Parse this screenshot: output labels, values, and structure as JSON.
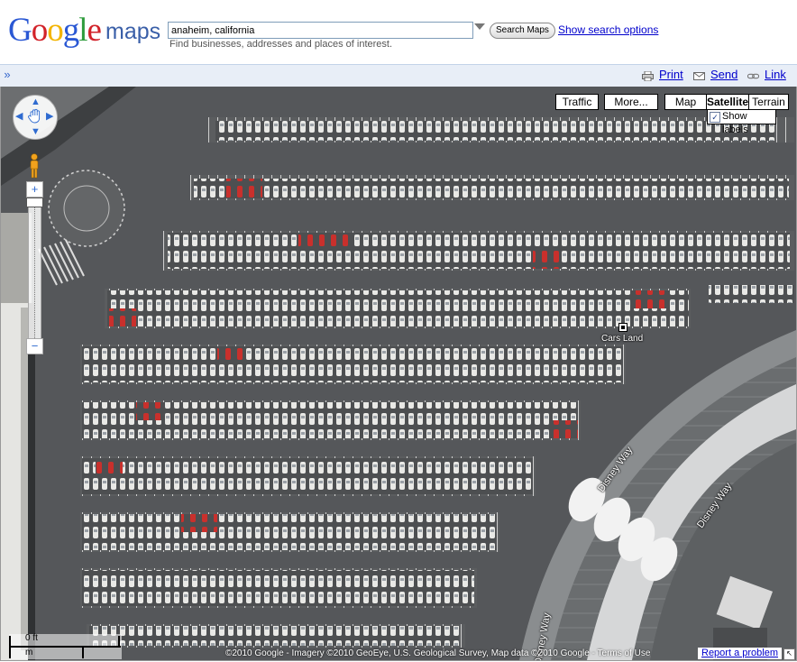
{
  "header": {
    "logo_google": "Google",
    "logo_maps": "maps",
    "search": {
      "value": "anaheim, california",
      "button_label": "Search Maps",
      "options_link": "Show search options",
      "hint": "Find businesses, addresses and places of interest."
    }
  },
  "toolbar": {
    "panel_toggle": "»",
    "print": "Print",
    "send": "Send",
    "link": "Link"
  },
  "map": {
    "map_types": [
      "Traffic",
      "More...",
      "Map",
      "Satellite",
      "Terrain"
    ],
    "active_map_type": "Satellite",
    "show_labels": {
      "label": "Show labels",
      "checked": true
    },
    "zoom": {
      "in": "+",
      "out": "−"
    },
    "place_label": "Cars Land",
    "road_labels": [
      "Disney Way",
      "Disney Way",
      "Disney Way"
    ],
    "scale": {
      "feet": "0 ft",
      "meters": "m"
    },
    "copyright": "©2010 Google - Imagery ©2010 GeoEye, U.S. Geological Survey, Map data ©2010 Google - Terms of Use",
    "report_problem": "Report a problem"
  },
  "colors": {
    "link": "#0000cc",
    "toolbar_bg": "#e8eef7",
    "asphalt": "#56585a"
  }
}
